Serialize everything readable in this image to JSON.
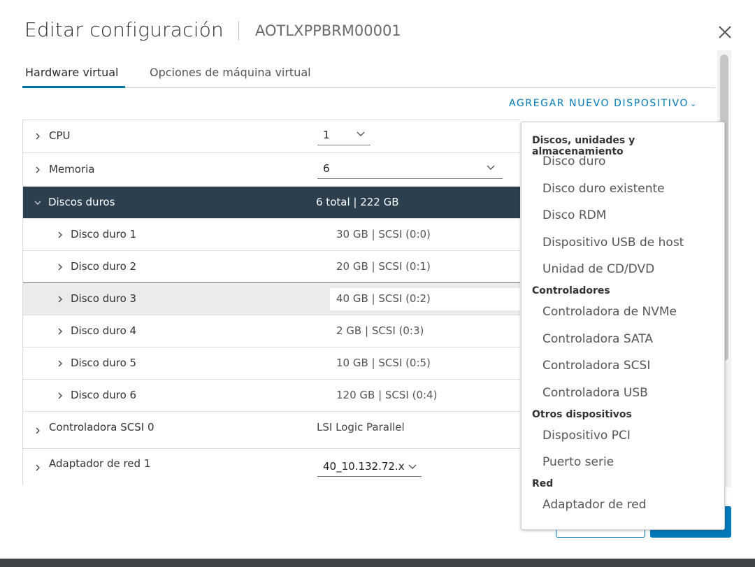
{
  "dialog": {
    "title": "Editar configuración",
    "vm_name": "AOTLXPPBRM00001"
  },
  "tabs": [
    {
      "label": "Hardware virtual",
      "active": true
    },
    {
      "label": "Opciones de máquina virtual",
      "active": false
    }
  ],
  "add_device_label": "AGREGAR NUEVO DISPOSITIVO",
  "rows": {
    "cpu": {
      "label": "CPU",
      "value": "1"
    },
    "memory": {
      "label": "Memoria",
      "value": "6"
    },
    "disks_header": {
      "label": "Discos duros",
      "value": "6 total | 222 GB"
    },
    "disks": [
      {
        "label": "Disco duro 1",
        "value": "30 GB | SCSI (0:0)"
      },
      {
        "label": "Disco duro 2",
        "value": "20 GB | SCSI (0:1)"
      },
      {
        "label": "Disco duro 3",
        "value": "40 GB | SCSI (0:2)"
      },
      {
        "label": "Disco duro 4",
        "value": "2 GB | SCSI (0:3)"
      },
      {
        "label": "Disco duro 5",
        "value": "10 GB | SCSI (0:5)"
      },
      {
        "label": "Disco duro 6",
        "value": "120 GB | SCSI (0:4)"
      }
    ],
    "scsi": {
      "label": "Controladora SCSI 0",
      "value": "LSI Logic Parallel"
    },
    "network": {
      "label": "Adaptador de red 1",
      "value": "40_10.132.72.x"
    }
  },
  "dropdown": {
    "groups": [
      {
        "header": "Discos, unidades y almacenamiento",
        "items": [
          "Disco duro",
          "Disco duro existente",
          "Disco RDM",
          "Dispositivo USB de host",
          "Unidad de CD/DVD"
        ]
      },
      {
        "header": "Controladores",
        "items": [
          "Controladora de NVMe",
          "Controladora SATA",
          "Controladora SCSI",
          "Controladora USB"
        ]
      },
      {
        "header": "Otros dispositivos",
        "items": [
          "Dispositivo PCI",
          "Puerto serie"
        ]
      },
      {
        "header": "Red",
        "items": [
          "Adaptador de red"
        ]
      }
    ]
  },
  "colors": {
    "accent": "#0079b8",
    "header_row": "#2b3f4e",
    "highlight_row": "#ebebeb"
  }
}
